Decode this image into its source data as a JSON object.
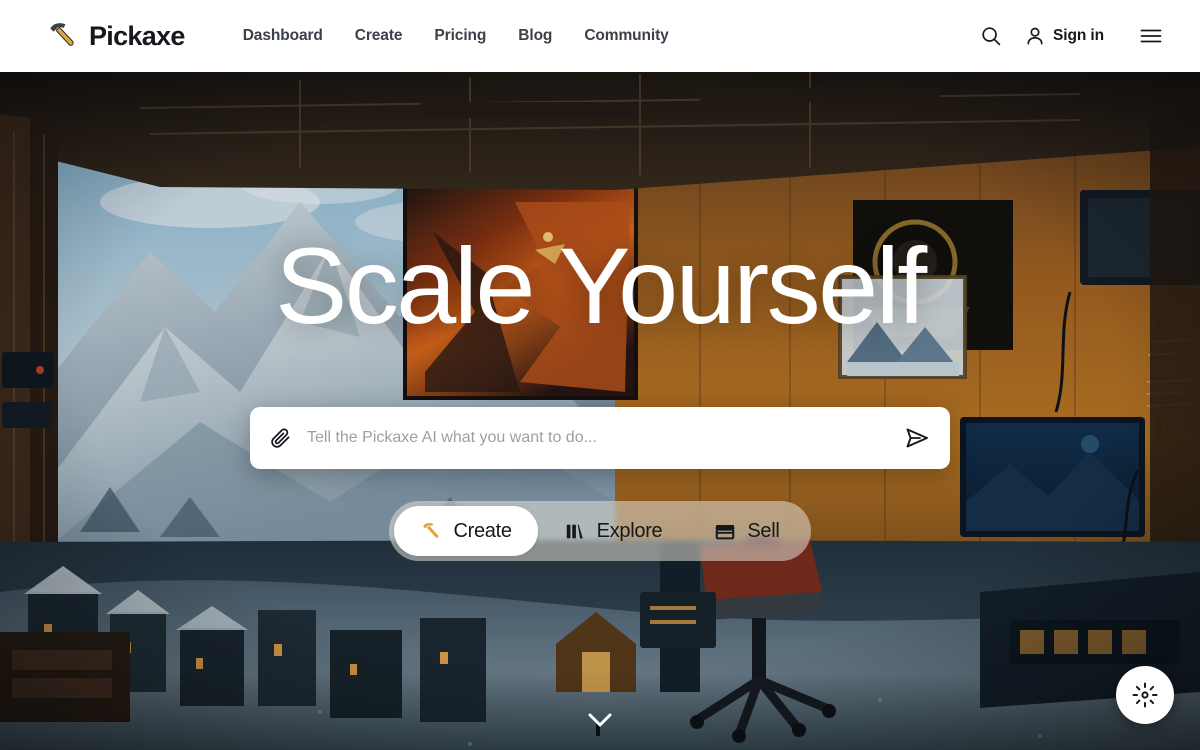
{
  "brand": {
    "name": "Pickaxe",
    "logo_icon": "pickaxe-icon",
    "logo_handle_color": "#e0a93b",
    "logo_head_color": "#3c3f44"
  },
  "nav": {
    "links": [
      {
        "label": "Dashboard"
      },
      {
        "label": "Create"
      },
      {
        "label": "Pricing"
      },
      {
        "label": "Blog"
      },
      {
        "label": "Community"
      }
    ],
    "search_icon": "search-icon",
    "account_icon": "user-icon",
    "signin_label": "Sign in",
    "menu_icon": "hamburger-menu-icon"
  },
  "hero": {
    "headline": "Scale Yourself",
    "prompt": {
      "placeholder": "Tell the Pickaxe AI what you want to do...",
      "value": "",
      "attach_icon": "paperclip-icon",
      "send_icon": "send-paper-plane-icon"
    },
    "segments": [
      {
        "label": "Create",
        "icon": "pickaxe-icon",
        "active": true
      },
      {
        "label": "Explore",
        "icon": "bar-chart-icon",
        "active": false
      },
      {
        "label": "Sell",
        "icon": "storefront-icon",
        "active": false
      }
    ],
    "scroll_hint_icon": "chevron-down-icon"
  },
  "floating_action": {
    "icon": "sparkle-burst-icon",
    "background_color": "#ffffff"
  },
  "colors": {
    "nav_background": "#ffffff",
    "nav_text": "#3b4148",
    "headline_text": "#ffffff",
    "accent_gold": "#e0a93b",
    "segment_group_background": "rgba(225,222,214,0.55)",
    "segment_active_background": "#ffffff"
  }
}
